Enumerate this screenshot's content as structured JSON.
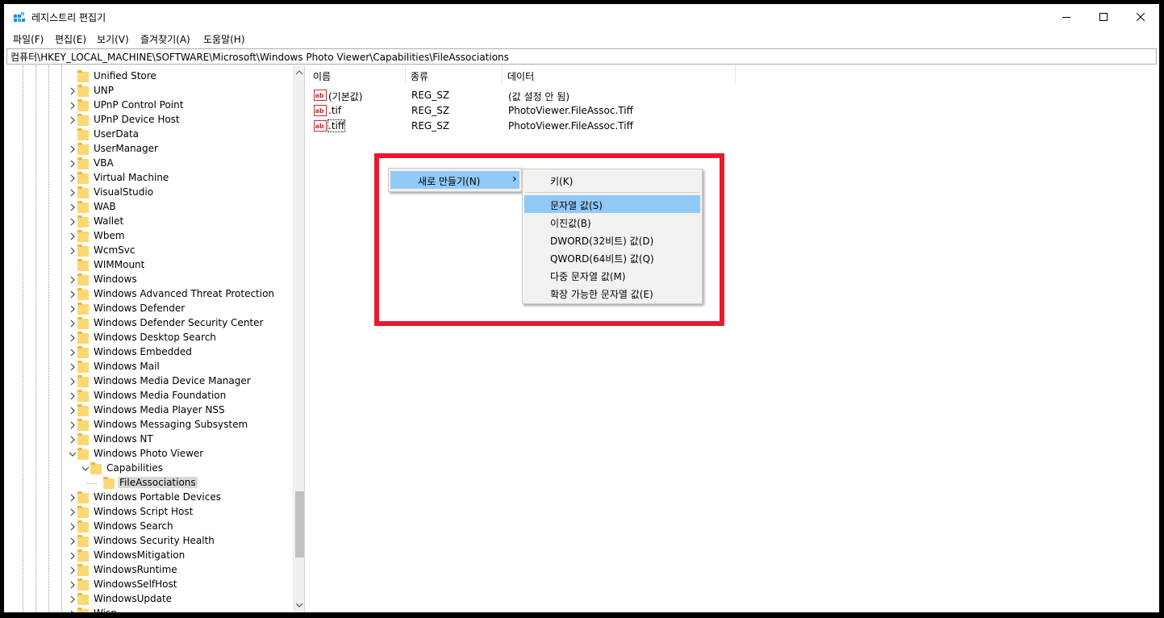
{
  "window": {
    "title": "레지스트리 편집기"
  },
  "menu": [
    "파일(F)",
    "편집(E)",
    "보기(V)",
    "즐겨찾기(A)",
    "도움말(H)"
  ],
  "address": "컴퓨터\\HKEY_LOCAL_MACHINE\\SOFTWARE\\Microsoft\\Windows Photo Viewer\\Capabilities\\FileAssociations",
  "tree": {
    "items": [
      {
        "label": "Unified Store",
        "expand": "none"
      },
      {
        "label": "UNP",
        "expand": "collapsed"
      },
      {
        "label": "UPnP Control Point",
        "expand": "collapsed"
      },
      {
        "label": "UPnP Device Host",
        "expand": "collapsed"
      },
      {
        "label": "UserData",
        "expand": "none"
      },
      {
        "label": "UserManager",
        "expand": "collapsed"
      },
      {
        "label": "VBA",
        "expand": "collapsed"
      },
      {
        "label": "Virtual Machine",
        "expand": "collapsed"
      },
      {
        "label": "VisualStudio",
        "expand": "collapsed"
      },
      {
        "label": "WAB",
        "expand": "collapsed"
      },
      {
        "label": "Wallet",
        "expand": "collapsed"
      },
      {
        "label": "Wbem",
        "expand": "collapsed"
      },
      {
        "label": "WcmSvc",
        "expand": "collapsed"
      },
      {
        "label": "WIMMount",
        "expand": "none"
      },
      {
        "label": "Windows",
        "expand": "collapsed"
      },
      {
        "label": "Windows Advanced Threat Protection",
        "expand": "collapsed"
      },
      {
        "label": "Windows Defender",
        "expand": "collapsed"
      },
      {
        "label": "Windows Defender Security Center",
        "expand": "collapsed"
      },
      {
        "label": "Windows Desktop Search",
        "expand": "collapsed"
      },
      {
        "label": "Windows Embedded",
        "expand": "collapsed"
      },
      {
        "label": "Windows Mail",
        "expand": "collapsed"
      },
      {
        "label": "Windows Media Device Manager",
        "expand": "collapsed"
      },
      {
        "label": "Windows Media Foundation",
        "expand": "collapsed"
      },
      {
        "label": "Windows Media Player NSS",
        "expand": "collapsed"
      },
      {
        "label": "Windows Messaging Subsystem",
        "expand": "collapsed"
      },
      {
        "label": "Windows NT",
        "expand": "collapsed"
      },
      {
        "label": "Windows Photo Viewer",
        "expand": "expanded"
      },
      {
        "label": "Capabilities",
        "expand": "expanded",
        "depth": 1
      },
      {
        "label": "FileAssociations",
        "expand": "none",
        "depth": 2,
        "selected": true
      },
      {
        "label": "Windows Portable Devices",
        "expand": "collapsed"
      },
      {
        "label": "Windows Script Host",
        "expand": "collapsed"
      },
      {
        "label": "Windows Search",
        "expand": "collapsed"
      },
      {
        "label": "Windows Security Health",
        "expand": "collapsed"
      },
      {
        "label": "WindowsMitigation",
        "expand": "collapsed"
      },
      {
        "label": "WindowsRuntime",
        "expand": "collapsed"
      },
      {
        "label": "WindowsSelfHost",
        "expand": "collapsed"
      },
      {
        "label": "WindowsUpdate",
        "expand": "collapsed"
      },
      {
        "label": "Wisp",
        "expand": "collapsed"
      }
    ]
  },
  "list": {
    "columns": [
      "이름",
      "종류",
      "데이터"
    ],
    "rows": [
      {
        "name": "(기본값)",
        "type": "REG_SZ",
        "data": "(값 설정 안 됨)"
      },
      {
        "name": ".tif",
        "type": "REG_SZ",
        "data": "PhotoViewer.FileAssoc.Tiff"
      },
      {
        "name": ".tiff",
        "type": "REG_SZ",
        "data": "PhotoViewer.FileAssoc.Tiff",
        "focused": true
      }
    ]
  },
  "context_menu": {
    "new_label": "새로 만들기(N)",
    "arrow": "›",
    "submenu": {
      "key_item": "키(K)",
      "items": [
        "문자열 값(S)",
        "이진값(B)",
        "DWORD(32비트) 값(D)",
        "QWORD(64비트) 값(Q)",
        "다중 문자열 값(M)",
        "확장 가능한 문자열 값(E)"
      ],
      "highlighted_index": 0
    }
  },
  "colors": {
    "highlight_box": "#e8192c",
    "menu_hover": "#91c9f7",
    "folder": "#fcd874"
  }
}
